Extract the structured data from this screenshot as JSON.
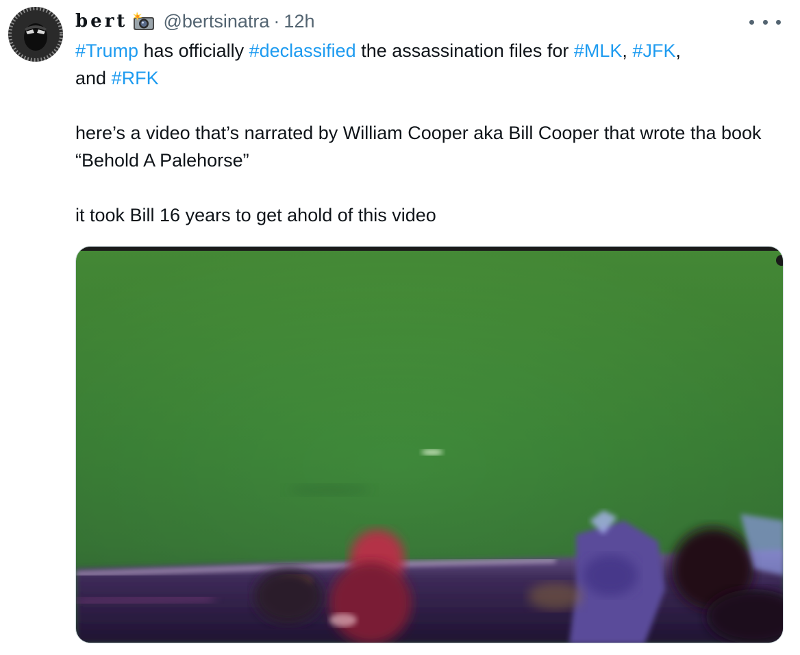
{
  "tweet": {
    "author": {
      "display_name": "bert",
      "badge_icon": "camera-flash-icon",
      "handle": "@bertsinatra",
      "separator": "·",
      "time": "12h"
    },
    "more_icon": "more-horizontal-icon",
    "text": {
      "line1": {
        "tag_trump": "#Trump",
        "part1": " has officially ",
        "tag_declassified": "#declassified",
        "part2": " the assassination files for ",
        "tag_mlk": "#MLK",
        "comma1": ", ",
        "tag_jfk": "#JFK",
        "comma2": ",",
        "and": " and ",
        "tag_rfk": "#RFK"
      },
      "paragraph2": "here’s a video that’s narrated by William Cooper aka Bill Cooper that wrote tha book “Behold A Palehorse”",
      "paragraph3": "it took Bill 16 years to get ahold of this video"
    },
    "media": {
      "type": "video",
      "colors": {
        "grass": "#3f8a3a",
        "car": "#2a1a3a",
        "accent": "#1d9bf0"
      }
    }
  }
}
